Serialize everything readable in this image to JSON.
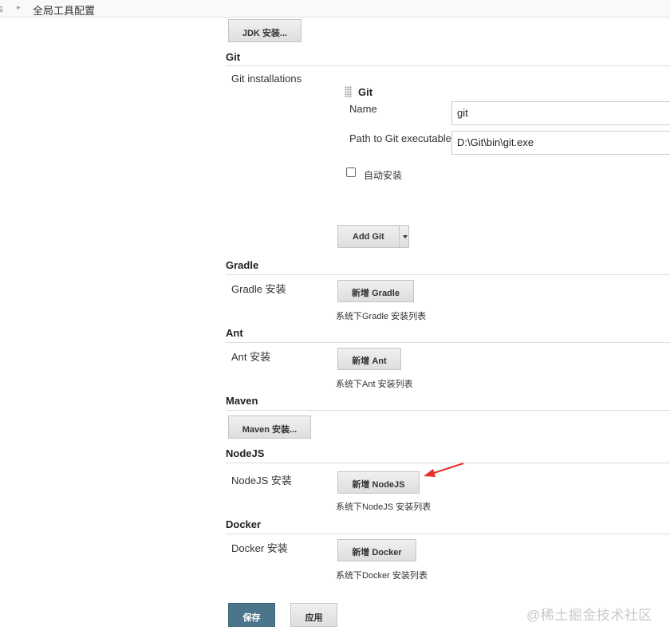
{
  "breadcrumb": {
    "previous": "s",
    "current": "全局工具配置"
  },
  "jdk": {
    "button": "JDK 安装..."
  },
  "git": {
    "section_title": "Git",
    "installations_label": "Git installations",
    "item_title": "Git",
    "name_label": "Name",
    "name_value": "git",
    "path_label": "Path to Git executable",
    "path_value": "D:\\Git\\bin\\git.exe",
    "auto_install_label": "自动安装",
    "auto_install_checked": false,
    "add_button": "Add Git"
  },
  "gradle": {
    "section_title": "Gradle",
    "label": "Gradle 安装",
    "button": "新增 Gradle",
    "description": "系统下Gradle 安装列表"
  },
  "ant": {
    "section_title": "Ant",
    "label": "Ant 安装",
    "button": "新增 Ant",
    "description": "系统下Ant 安装列表"
  },
  "maven": {
    "section_title": "Maven",
    "button": "Maven 安装..."
  },
  "nodejs": {
    "section_title": "NodeJS",
    "label": "NodeJS 安装",
    "button": "新增 NodeJS",
    "description": "系统下NodeJS 安装列表"
  },
  "docker": {
    "section_title": "Docker",
    "label": "Docker 安装",
    "button": "新增 Docker",
    "description": "系统下Docker 安装列表"
  },
  "footer": {
    "save_button": "保存",
    "apply_button": "应用"
  },
  "annotation": {
    "arrow_color": "#e8302a"
  },
  "watermark": "@稀土掘金技术社区",
  "colors": {
    "primary": "#4b758b",
    "section_rule": "#dddddd"
  }
}
